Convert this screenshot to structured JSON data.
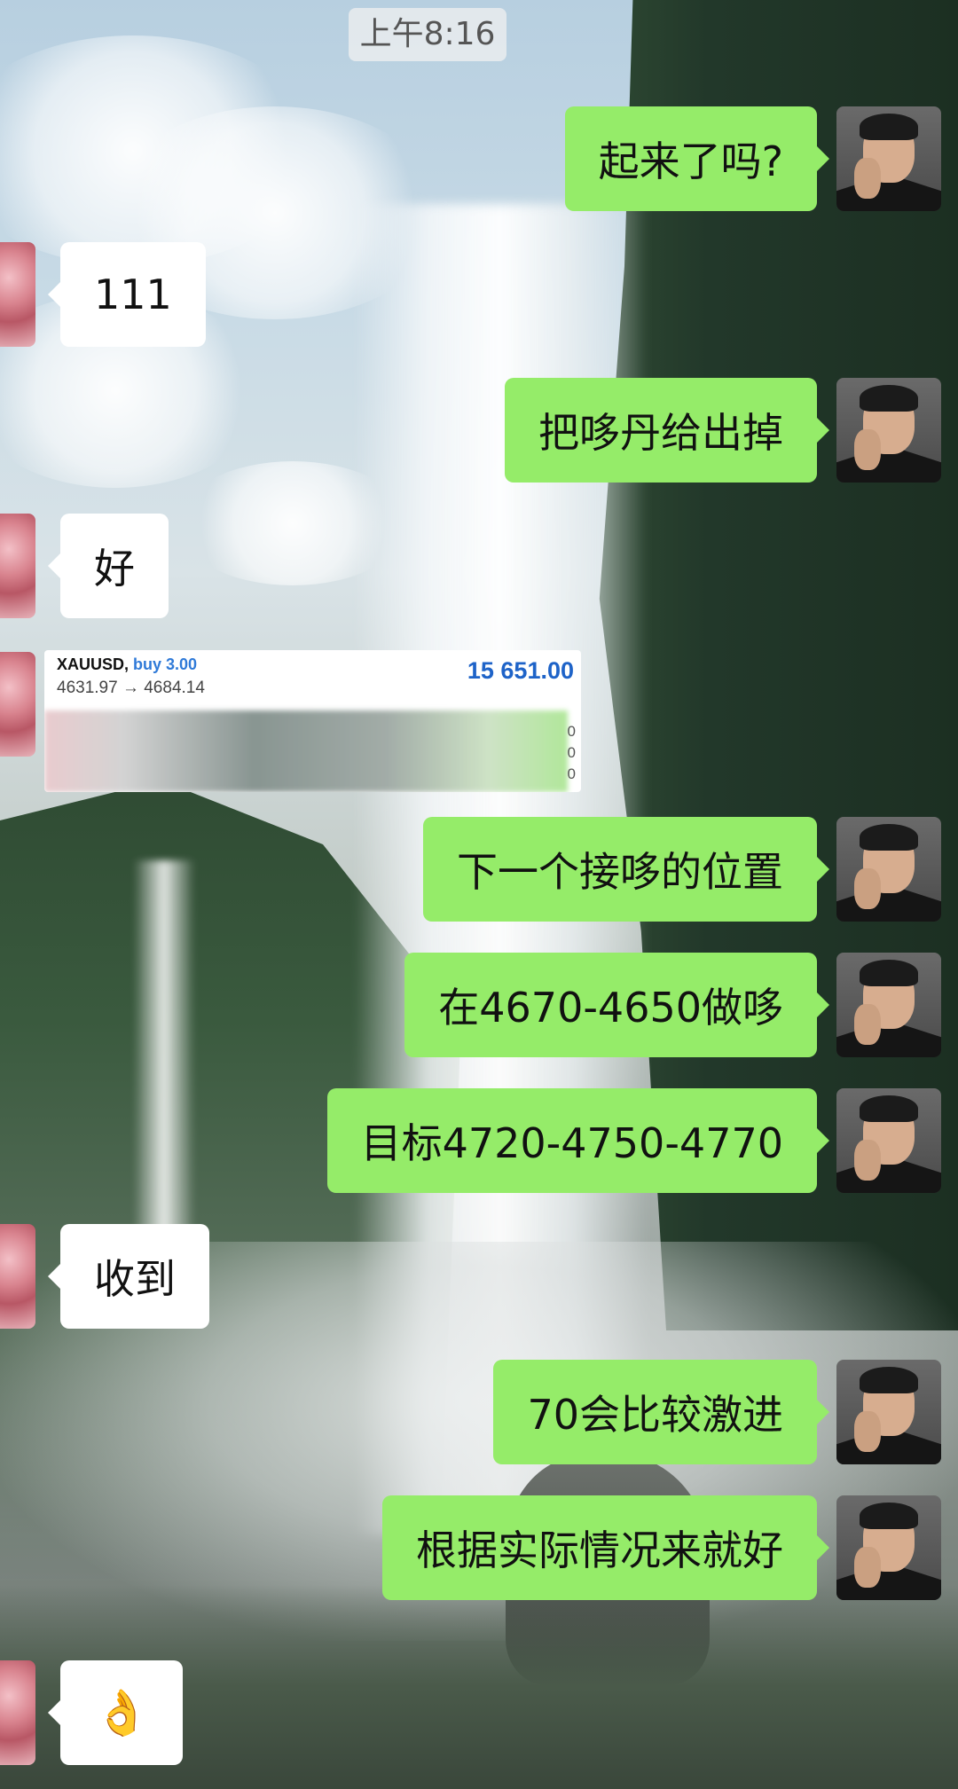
{
  "status": {
    "time": "上午8:16"
  },
  "messages": [
    {
      "side": "right",
      "text": "起来了吗?"
    },
    {
      "side": "left",
      "text": "111"
    },
    {
      "side": "right",
      "text": "把哆丹给出掉"
    },
    {
      "side": "left",
      "text": "好"
    },
    {
      "side": "left",
      "type": "trade_card"
    },
    {
      "side": "right",
      "text": "下一个接哆的位置"
    },
    {
      "side": "right",
      "text": "在4670-4650做哆"
    },
    {
      "side": "right",
      "text": "目标4720-4750-4770"
    },
    {
      "side": "left",
      "text": "收到"
    },
    {
      "side": "right",
      "text": "70会比较激进"
    },
    {
      "side": "right",
      "text": "根据实际情况来就好"
    },
    {
      "side": "left",
      "emoji": "👌"
    }
  ],
  "trade_card": {
    "symbol": "XAUUSD,",
    "action": "buy 3.00",
    "price_change": "4631.97 → 4684.14",
    "profit": "15 651.00",
    "edge_digits": [
      "0",
      "0",
      "0"
    ]
  },
  "colors": {
    "sent_bubble": "#95ec69",
    "received_bubble": "#ffffff",
    "profit_blue": "#1e63c8"
  }
}
